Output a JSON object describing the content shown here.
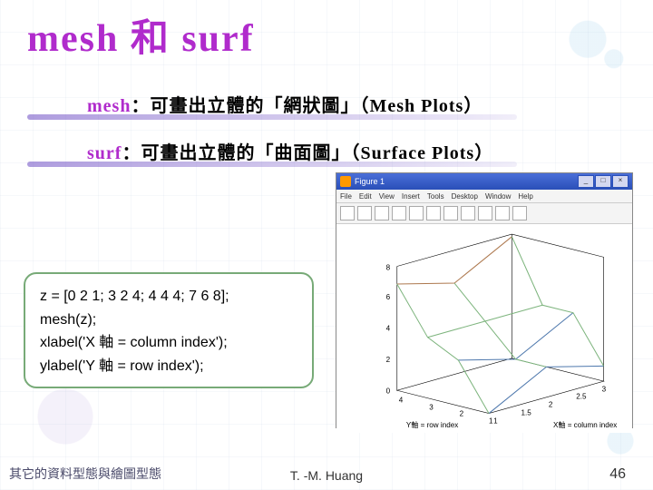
{
  "title": "mesh 和 surf",
  "bullets": {
    "mesh": {
      "kw": "mesh",
      "text": "：可畫出立體的「網狀圖」（Mesh Plots）"
    },
    "surf": {
      "kw": "surf",
      "text": "：可畫出立體的「曲面圖」（Surface Plots）"
    }
  },
  "code": {
    "l1": "z = [0 2 1; 3 2 4; 4 4 4; 7 6 8];",
    "l2": "mesh(z);",
    "l3": "xlabel('X 軸 = column index');",
    "l4": "ylabel('Y 軸 = row index');"
  },
  "figure": {
    "title": "Figure 1",
    "menu": [
      "File",
      "Edit",
      "View",
      "Insert",
      "Tools",
      "Desktop",
      "Window",
      "Help"
    ],
    "xlabel": "X軸 = column index",
    "ylabel": "Y軸 = row index",
    "xticks": [
      "1",
      "1.5",
      "2",
      "2.5",
      "3"
    ],
    "yticks": [
      "4",
      "3",
      "2",
      "1"
    ],
    "zticks": [
      "0",
      "2",
      "4",
      "6",
      "8"
    ]
  },
  "footer": {
    "left": "其它的資料型態與繪圖型態",
    "center": "T. -M. Huang",
    "right": "46"
  },
  "chart_data": {
    "type": "line",
    "description": "3D mesh plot of 4x3 matrix z",
    "x": [
      1,
      2,
      3
    ],
    "y": [
      1,
      2,
      3,
      4
    ],
    "z_matrix": [
      [
        0,
        2,
        1
      ],
      [
        3,
        2,
        4
      ],
      [
        4,
        4,
        4
      ],
      [
        7,
        6,
        8
      ]
    ],
    "xlabel": "X 軸 = column index",
    "ylabel": "Y 軸 = row index",
    "zlim": [
      0,
      8
    ],
    "xlim": [
      1,
      3
    ],
    "ylim": [
      1,
      4
    ]
  }
}
